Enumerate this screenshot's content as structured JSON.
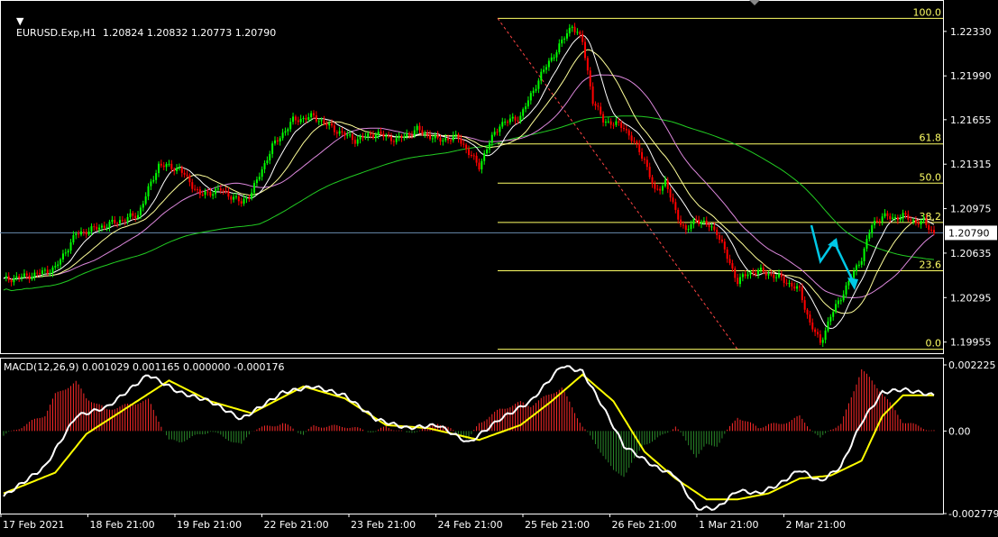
{
  "symbol_header": "EURUSD.Exp,H1  1.20824 1.20832 1.20773 1.20790",
  "macd_header": "MACD(12,26,9) 0.001029 0.001165 0.000000 -0.000176",
  "price_axis": {
    "labels": [
      "1.22330",
      "1.21990",
      "1.21655",
      "1.21315",
      "1.20975",
      "1.20635",
      "1.20295",
      "1.19955"
    ],
    "current": "1.20790",
    "range": [
      1.1987,
      1.2257
    ]
  },
  "macd_axis": {
    "labels": [
      "0.002225",
      "0.00",
      "-0.002779"
    ],
    "range": [
      -0.002779,
      0.002225
    ]
  },
  "time_axis": {
    "labels": [
      "17 Feb 2021",
      "18 Feb 21:00",
      "19 Feb 21:00",
      "22 Feb 21:00",
      "23 Feb 21:00",
      "24 Feb 21:00",
      "25 Feb 21:00",
      "26 Feb 21:00",
      "1 Mar 21:00",
      "2 Mar 21:00"
    ]
  },
  "fibonacci": {
    "levels": [
      {
        "label": "100.0",
        "price": 1.2243
      },
      {
        "label": "61.8",
        "price": 1.2147
      },
      {
        "label": "50.0",
        "price": 1.2117
      },
      {
        "label": "38.2",
        "price": 1.2087
      },
      {
        "label": "23.6",
        "price": 1.205
      },
      {
        "label": "0.0",
        "price": 1.199
      }
    ]
  },
  "colors": {
    "background": "#000000",
    "axis": "#ffffff",
    "bull_candle": "#00ff00",
    "bear_candle": "#ff0000",
    "fib": "#ffff66",
    "ma_fast": "#ffffff",
    "ma_mid": "#ffff99",
    "ma_slow": "#dd88dd",
    "ma_long": "#22cc22",
    "current_price_line": "#6a8caf",
    "arrow": "#00c8e6",
    "macd_main": "#ffffff",
    "macd_signal": "#ffff00",
    "hist_pos": "#ff2a2a",
    "hist_neg": "#2a8a2a"
  },
  "chart_data": [
    {
      "type": "candlestick",
      "symbol": "EURUSD.Exp",
      "timeframe": "H1",
      "ohlc": [
        1.20824,
        1.20832,
        1.20773,
        1.2079
      ],
      "close_path": [
        [
          0,
          1.2043
        ],
        [
          3,
          1.2047
        ],
        [
          5,
          1.2052
        ],
        [
          7,
          1.2078
        ],
        [
          10,
          1.2085
        ],
        [
          13,
          1.2093
        ],
        [
          15,
          1.2131
        ],
        [
          17,
          1.2128
        ],
        [
          19,
          1.2108
        ],
        [
          21,
          1.2112
        ],
        [
          23,
          1.2102
        ],
        [
          24,
          1.211
        ],
        [
          26,
          1.2145
        ],
        [
          28,
          1.2165
        ],
        [
          30,
          1.2168
        ],
        [
          32,
          1.2158
        ],
        [
          34,
          1.215
        ],
        [
          36,
          1.2155
        ],
        [
          38,
          1.215
        ],
        [
          40,
          1.2158
        ],
        [
          42,
          1.215
        ],
        [
          44,
          1.2152
        ],
        [
          45,
          1.214
        ],
        [
          46,
          1.213
        ],
        [
          47,
          1.2148
        ],
        [
          48,
          1.2162
        ],
        [
          50,
          1.2168
        ],
        [
          52,
          1.22
        ],
        [
          54,
          1.2225
        ],
        [
          55,
          1.2238
        ],
        [
          56,
          1.2225
        ],
        [
          57,
          1.218
        ],
        [
          58,
          1.2165
        ],
        [
          60,
          1.216
        ],
        [
          62,
          1.2135
        ],
        [
          63,
          1.211
        ],
        [
          64,
          1.2118
        ],
        [
          65,
          1.2095
        ],
        [
          66,
          1.208
        ],
        [
          67,
          1.209
        ],
        [
          68,
          1.2085
        ],
        [
          69,
          1.208
        ],
        [
          70,
          1.206
        ],
        [
          71,
          1.2042
        ],
        [
          72,
          1.2048
        ],
        [
          73,
          1.205
        ],
        [
          75,
          1.2045
        ],
        [
          77,
          1.2035
        ],
        [
          78,
          1.201
        ],
        [
          79,
          1.1995
        ],
        [
          80,
          1.2015
        ],
        [
          81,
          1.203
        ],
        [
          82,
          1.2045
        ],
        [
          83,
          1.206
        ],
        [
          84,
          1.2085
        ],
        [
          85,
          1.2092
        ],
        [
          86,
          1.209
        ],
        [
          87,
          1.2092
        ],
        [
          88,
          1.2088
        ],
        [
          89,
          1.2087
        ],
        [
          90,
          1.2079
        ]
      ]
    },
    {
      "type": "bar",
      "name": "MACD(12,26,9)",
      "values": [
        0.001029,
        0.001165,
        0.0,
        -0.000176
      ],
      "main_path": [
        [
          0,
          -0.0022
        ],
        [
          4,
          -0.0012
        ],
        [
          7,
          0.0005
        ],
        [
          10,
          0.0008
        ],
        [
          14,
          0.0019
        ],
        [
          17,
          0.0013
        ],
        [
          20,
          0.001
        ],
        [
          23,
          0.0004
        ],
        [
          27,
          0.0013
        ],
        [
          30,
          0.0015
        ],
        [
          33,
          0.0012
        ],
        [
          36,
          0.0004
        ],
        [
          39,
          0.0001
        ],
        [
          42,
          0.0002
        ],
        [
          45,
          -0.0004
        ],
        [
          48,
          0.0004
        ],
        [
          51,
          0.001
        ],
        [
          54,
          0.0022
        ],
        [
          56,
          0.002
        ],
        [
          58,
          0.0008
        ],
        [
          60,
          -0.0005
        ],
        [
          63,
          -0.0012
        ],
        [
          65,
          -0.0015
        ],
        [
          67,
          -0.0026
        ],
        [
          69,
          -0.0026
        ],
        [
          71,
          -0.002
        ],
        [
          73,
          -0.0021
        ],
        [
          75,
          -0.0018
        ],
        [
          77,
          -0.0013
        ],
        [
          79,
          -0.0017
        ],
        [
          81,
          -0.0012
        ],
        [
          83,
          0.0003
        ],
        [
          85,
          0.0013
        ],
        [
          87,
          0.0014
        ],
        [
          90,
          0.0012
        ]
      ],
      "signal_path": [
        [
          0,
          -0.0021
        ],
        [
          5,
          -0.0014
        ],
        [
          8,
          -0.0001
        ],
        [
          12,
          0.0008
        ],
        [
          16,
          0.0017
        ],
        [
          20,
          0.001
        ],
        [
          24,
          0.0006
        ],
        [
          29,
          0.0015
        ],
        [
          33,
          0.0011
        ],
        [
          37,
          0.0002
        ],
        [
          41,
          0.0001
        ],
        [
          46,
          -0.0003
        ],
        [
          50,
          0.0002
        ],
        [
          53,
          0.001
        ],
        [
          56,
          0.0019
        ],
        [
          59,
          0.001
        ],
        [
          62,
          -0.0007
        ],
        [
          65,
          -0.0016
        ],
        [
          68,
          -0.0023
        ],
        [
          71,
          -0.0023
        ],
        [
          74,
          -0.0021
        ],
        [
          77,
          -0.0016
        ],
        [
          80,
          -0.0015
        ],
        [
          83,
          -0.001
        ],
        [
          85,
          0.0005
        ],
        [
          87,
          0.0012
        ],
        [
          90,
          0.0012
        ]
      ]
    }
  ]
}
